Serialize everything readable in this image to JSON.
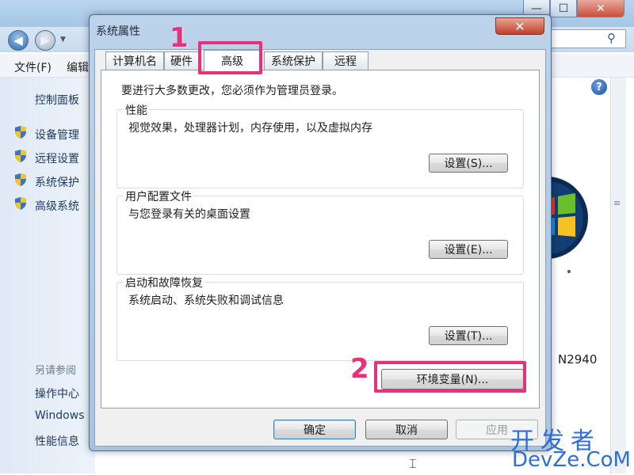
{
  "background_window": {
    "caption_buttons": {
      "minimize": "—",
      "maximize": "☐",
      "close": "✕"
    },
    "menu": [
      "文件(F)",
      "编辑"
    ],
    "sidebar": {
      "home_link": "控制面板",
      "links": [
        "设备管理",
        "远程设置",
        "系统保护",
        "高级系统"
      ],
      "see_also_label": "另请参阅",
      "see_also": [
        "操作中心",
        "Windows",
        "性能信息"
      ]
    },
    "model_text": "N2940",
    "help_glyph": "?",
    "scroll_grip": "≡"
  },
  "dialog": {
    "title": "系统属性",
    "close_glyph": "✕",
    "tabs": [
      {
        "label": "计算机名",
        "active": false
      },
      {
        "label": "硬件",
        "active": false
      },
      {
        "label": "高级",
        "active": true
      },
      {
        "label": "系统保护",
        "active": false
      },
      {
        "label": "远程",
        "active": false
      }
    ],
    "admin_note": "要进行大多数更改，您必须作为管理员登录。",
    "groups": {
      "performance": {
        "title": "性能",
        "desc": "视觉效果，处理器计划，内存使用，以及虚拟内存",
        "button": "设置(S)..."
      },
      "user_profiles": {
        "title": "用户配置文件",
        "desc": "与您登录有关的桌面设置",
        "button": "设置(E)..."
      },
      "startup_recovery": {
        "title": "启动和故障恢复",
        "desc": "系统启动、系统失败和调试信息",
        "button": "设置(T)..."
      }
    },
    "env_button": "环境变量(N)...",
    "footer": {
      "ok": "确定",
      "cancel": "取消",
      "apply": "应用"
    }
  },
  "annotations": {
    "step1": "1",
    "step2": "2",
    "color": "#e6327a"
  },
  "watermark": {
    "cn": "开发者",
    "en": "DevZe.CoM"
  },
  "colors": {
    "accent_blue": "#2d6fd6",
    "annotation_pink": "#e6327a",
    "close_red": "#c1412b"
  }
}
